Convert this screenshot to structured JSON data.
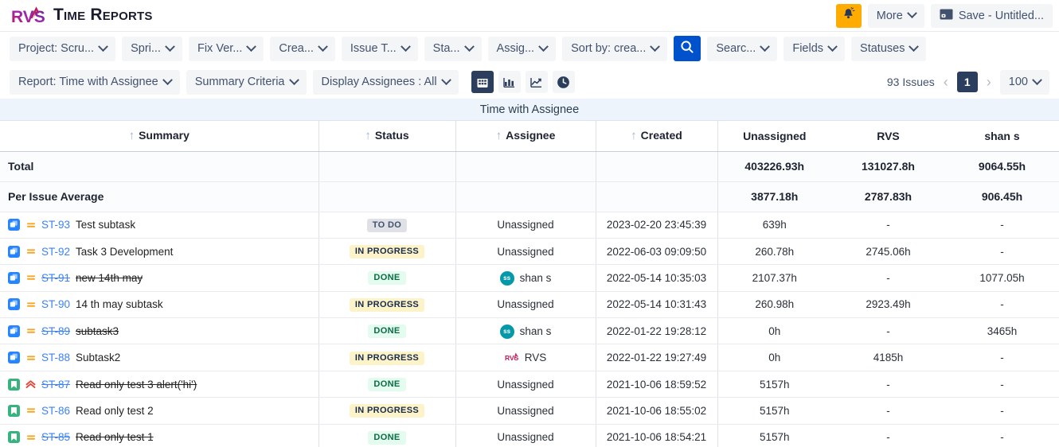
{
  "header": {
    "app_title": "Time Reports",
    "logo_alt": "rvs-logo",
    "notification_icon": "bell-icon",
    "more_label": "More",
    "save_label": "Save - Untitled...",
    "save_icon": "save-icon"
  },
  "filters": [
    {
      "label": "Project: Scru...",
      "name": "filter-project"
    },
    {
      "label": "Spri...",
      "name": "filter-sprint"
    },
    {
      "label": "Fix Ver...",
      "name": "filter-fix-version"
    },
    {
      "label": "Crea...",
      "name": "filter-created"
    },
    {
      "label": "Issue T...",
      "name": "filter-issue-type"
    },
    {
      "label": "Sta...",
      "name": "filter-status"
    },
    {
      "label": "Assig...",
      "name": "filter-assignee"
    },
    {
      "label": "Sort by: crea...",
      "name": "filter-sort-by"
    }
  ],
  "filters_right": [
    {
      "label": "Searc...",
      "name": "filter-search"
    },
    {
      "label": "Fields",
      "name": "filter-fields"
    },
    {
      "label": "Statuses",
      "name": "filter-statuses"
    }
  ],
  "search_icon": "search-icon",
  "options": [
    {
      "label": "Report: Time with Assignee",
      "name": "option-report"
    },
    {
      "label": "Summary Criteria",
      "name": "option-summary-criteria"
    },
    {
      "label": "Display Assignees : All",
      "name": "option-display-assignees"
    }
  ],
  "view_icons": [
    {
      "name": "table-view-icon",
      "active": true
    },
    {
      "name": "bar-chart-view-icon",
      "active": false
    },
    {
      "name": "line-chart-view-icon",
      "active": false
    },
    {
      "name": "clock-view-icon",
      "active": false
    }
  ],
  "pager": {
    "issues_count": "93 Issues",
    "prev_icon": "chevron-left-icon",
    "next_icon": "chevron-right-icon",
    "current_page": "1",
    "page_size": "100"
  },
  "report": {
    "title": "Time with Assignee",
    "columns": [
      "Summary",
      "Status",
      "Assignee",
      "Created",
      "Unassigned",
      "RVS",
      "shan s"
    ],
    "summary_rows": [
      {
        "label": "Total",
        "values": [
          "403226.93h",
          "131027.8h",
          "9064.55h"
        ]
      },
      {
        "label": "Per Issue Average",
        "values": [
          "3877.18h",
          "2787.83h",
          "906.45h"
        ]
      }
    ],
    "rows": [
      {
        "type": "subtask",
        "priority": "medium",
        "key": "ST-93",
        "summary": "Test subtask",
        "struck": false,
        "status": "TO DO",
        "status_kind": "todo",
        "assignee": "Unassigned",
        "assignee_avatar": "",
        "created": "2023-02-20 23:45:39",
        "values": [
          "639h",
          "-",
          "-"
        ]
      },
      {
        "type": "subtask",
        "priority": "medium",
        "key": "ST-92",
        "summary": "Task 3 Development",
        "struck": false,
        "status": "IN PROGRESS",
        "status_kind": "inprogress",
        "assignee": "Unassigned",
        "assignee_avatar": "",
        "created": "2022-06-03 09:09:50",
        "values": [
          "260.78h",
          "2745.06h",
          "-"
        ]
      },
      {
        "type": "subtask",
        "priority": "medium",
        "key": "ST-91",
        "summary": "new 14th may",
        "struck": true,
        "status": "DONE",
        "status_kind": "done",
        "assignee": "shan s",
        "assignee_avatar": "ss",
        "created": "2022-05-14 10:35:03",
        "values": [
          "2107.37h",
          "-",
          "1077.05h"
        ]
      },
      {
        "type": "subtask",
        "priority": "medium",
        "key": "ST-90",
        "summary": "14 th may subtask",
        "struck": false,
        "status": "IN PROGRESS",
        "status_kind": "inprogress",
        "assignee": "Unassigned",
        "assignee_avatar": "",
        "created": "2022-05-14 10:31:43",
        "values": [
          "260.98h",
          "2923.49h",
          "-"
        ]
      },
      {
        "type": "subtask",
        "priority": "medium",
        "key": "ST-89",
        "summary": "subtask3",
        "struck": true,
        "status": "DONE",
        "status_kind": "done",
        "assignee": "shan s",
        "assignee_avatar": "ss",
        "created": "2022-01-22 19:28:12",
        "values": [
          "0h",
          "-",
          "3465h"
        ]
      },
      {
        "type": "subtask",
        "priority": "medium",
        "key": "ST-88",
        "summary": "Subtask2",
        "struck": false,
        "status": "IN PROGRESS",
        "status_kind": "inprogress",
        "assignee": "RVS",
        "assignee_avatar": "rvs",
        "created": "2022-01-22 19:27:49",
        "values": [
          "0h",
          "4185h",
          "-"
        ]
      },
      {
        "type": "story",
        "priority": "highest",
        "key": "ST-87",
        "summary": "Read only test 3 alert('hi')",
        "struck": true,
        "status": "DONE",
        "status_kind": "done",
        "assignee": "Unassigned",
        "assignee_avatar": "",
        "created": "2021-10-06 18:59:52",
        "values": [
          "5157h",
          "-",
          "-"
        ]
      },
      {
        "type": "story",
        "priority": "medium",
        "key": "ST-86",
        "summary": "Read only test 2",
        "struck": false,
        "status": "IN PROGRESS",
        "status_kind": "inprogress",
        "assignee": "Unassigned",
        "assignee_avatar": "",
        "created": "2021-10-06 18:55:02",
        "values": [
          "5157h",
          "-",
          "-"
        ]
      },
      {
        "type": "story",
        "priority": "medium",
        "key": "ST-85",
        "summary": "Read only test 1",
        "struck": true,
        "status": "DONE",
        "status_kind": "done",
        "assignee": "Unassigned",
        "assignee_avatar": "",
        "created": "2021-10-06 18:54:21",
        "values": [
          "5157h",
          "-",
          "-"
        ]
      }
    ]
  },
  "colors": {
    "accent_blue": "#0052cc",
    "navy": "#2c3e5d",
    "orange": "#ffab00",
    "green": "#36b37e",
    "link": "#3b82f6",
    "teal": "#0598a8"
  }
}
